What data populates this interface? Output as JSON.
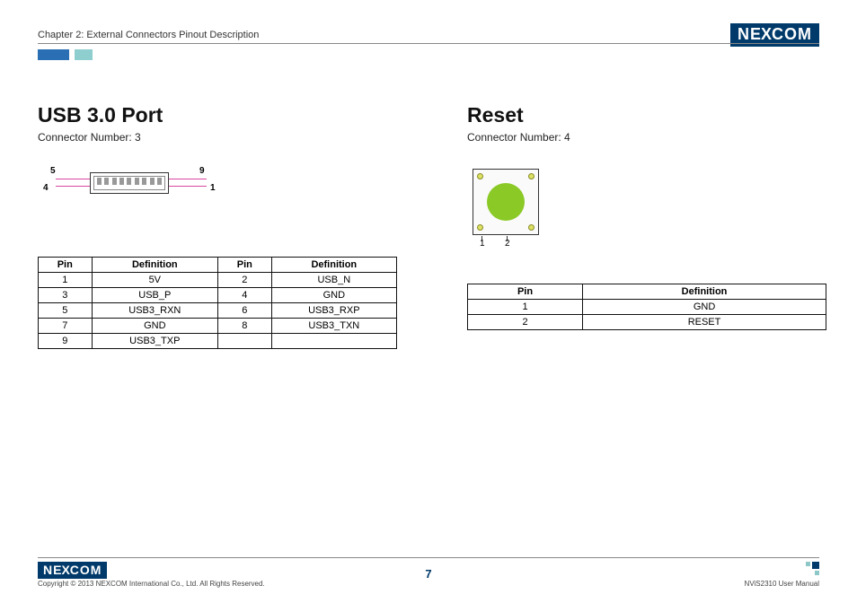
{
  "header": {
    "chapter": "Chapter 2: External Connectors Pinout Description",
    "logo": "NEXCOM"
  },
  "usb": {
    "title": "USB 3.0 Port",
    "connector": "Connector Number: 3",
    "labels": {
      "p4": "4",
      "p5": "5",
      "p9": "9",
      "p1": "1"
    },
    "headers": {
      "pin": "Pin",
      "def": "Definition"
    },
    "rows": [
      {
        "pinA": "1",
        "defA": "5V",
        "pinB": "2",
        "defB": "USB_N"
      },
      {
        "pinA": "3",
        "defA": "USB_P",
        "pinB": "4",
        "defB": "GND"
      },
      {
        "pinA": "5",
        "defA": "USB3_RXN",
        "pinB": "6",
        "defB": "USB3_RXP"
      },
      {
        "pinA": "7",
        "defA": "GND",
        "pinB": "8",
        "defB": "USB3_TXN"
      },
      {
        "pinA": "9",
        "defA": "USB3_TXP",
        "pinB": "",
        "defB": ""
      }
    ]
  },
  "reset": {
    "title": "Reset",
    "connector": "Connector Number: 4",
    "labels": {
      "p1": "1",
      "p2": "2"
    },
    "headers": {
      "pin": "Pin",
      "def": "Definition"
    },
    "rows": [
      {
        "pin": "1",
        "def": "GND"
      },
      {
        "pin": "2",
        "def": "RESET"
      }
    ]
  },
  "footer": {
    "copyright": "Copyright © 2013 NEXCOM International Co., Ltd. All Rights Reserved.",
    "page": "7",
    "manual": "NViS2310 User Manual",
    "logo": "NEXCOM"
  }
}
